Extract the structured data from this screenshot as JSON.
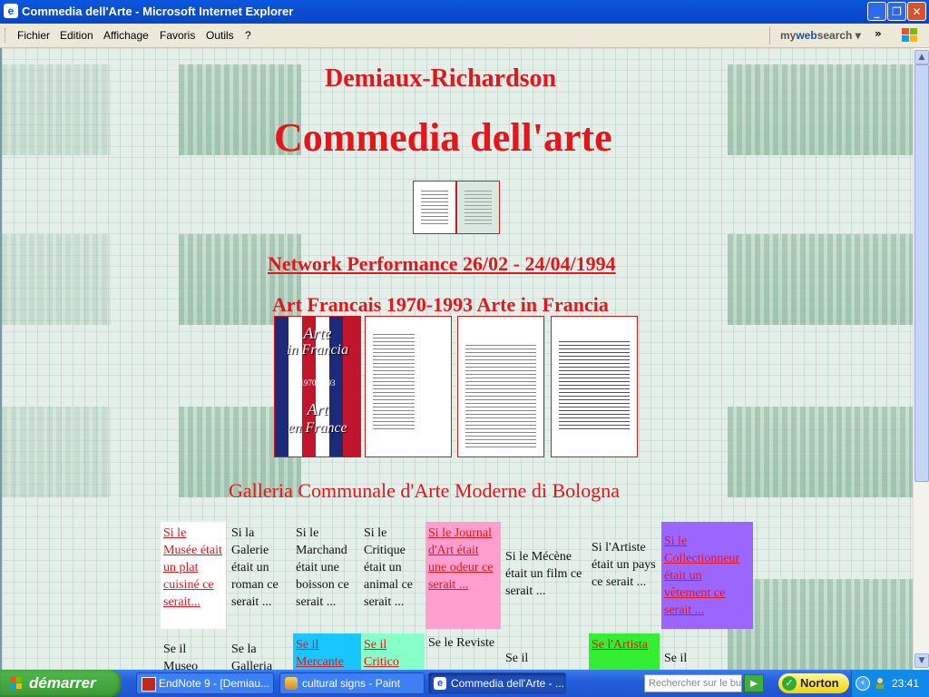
{
  "window": {
    "title": "Commedia dell'Arte - Microsoft Internet Explorer",
    "app_icon": "ie-icon",
    "controls": {
      "minimize": "_",
      "maximize": "❐",
      "close": "✕"
    }
  },
  "menubar": {
    "items": [
      "Fichier",
      "Edition",
      "Affichage",
      "Favoris",
      "Outils",
      "?"
    ],
    "toolbar_brand_prefix": "my",
    "toolbar_brand_main": "websearch",
    "toolbar_brand_suffix": "search",
    "toolbar_dropdown": "▾",
    "chevron": "»"
  },
  "page": {
    "heading_artists": "Demiaux-Richardson",
    "heading_title": "Commedia dell'arte",
    "network": "Network Performance 26/02 - 24/04/1994",
    "exhibition": "Art Francais 1970-1993 Arte in Francia",
    "cover": {
      "line1": "Arte",
      "line2": "in Francia",
      "line3": "1970-1993",
      "line4": "Art",
      "line5": "en France"
    },
    "gallery": "Galleria Communale d'Arte Moderne di Bologna",
    "grid_row1": [
      {
        "text": "Si le Musée était un plat cuisiné ce serait...",
        "link": true,
        "bg": "#ffffff"
      },
      {
        "text": "Si la Galerie était un roman ce serait ...",
        "link": false,
        "bg": ""
      },
      {
        "text": "Si le Marchand était une boisson ce serait ...",
        "link": false,
        "bg": ""
      },
      {
        "text": "Si le Critique était un animal ce serait ...",
        "link": false,
        "bg": ""
      },
      {
        "text": "Si le Journal d'Art était une odeur ce serait ...",
        "link": true,
        "bg": "#ff9fd0"
      },
      {
        "text": "Si le Mécène était un film ce serait ...",
        "link": false,
        "bg": ""
      },
      {
        "text": "Si l'Artiste était un pays ce serait ...",
        "link": false,
        "bg": ""
      },
      {
        "text": "Si le Collectionneur était un vêtement ce serait ...",
        "link": true,
        "bg": "#9a66ff"
      }
    ],
    "grid_row2": [
      {
        "text": "Se il Museo",
        "link": false,
        "bg": ""
      },
      {
        "text": "Se la Galleria",
        "link": false,
        "bg": ""
      },
      {
        "text": "Se il Mercante",
        "link": true,
        "bg": "#19c6ff"
      },
      {
        "text": "Se il Critico",
        "link": true,
        "bg": "#86ffc8"
      },
      {
        "text": "Se le Reviste",
        "link": false,
        "bg": ""
      },
      {
        "text": "Se il",
        "link": false,
        "bg": ""
      },
      {
        "text": "Se l'Artista",
        "link": true,
        "bg": "#33ee33"
      },
      {
        "text": "Se il",
        "link": false,
        "bg": ""
      }
    ]
  },
  "taskbar": {
    "start_label": "démarrer",
    "tasks": [
      {
        "label": "EndNote 9 - [Demiau...",
        "icon": "endnote-icon"
      },
      {
        "label": "cultural signs - Paint",
        "icon": "paint-icon"
      },
      {
        "label": "Commedia dell'Arte - ...",
        "icon": "ie-icon",
        "active": true
      }
    ],
    "search_placeholder": "Rechercher sur le bureau",
    "search_go": "▶",
    "norton_label": "Norton",
    "tray_expand": "‹",
    "clock": "23:41"
  },
  "scrollbar": {
    "up": "▲",
    "down": "▼"
  }
}
